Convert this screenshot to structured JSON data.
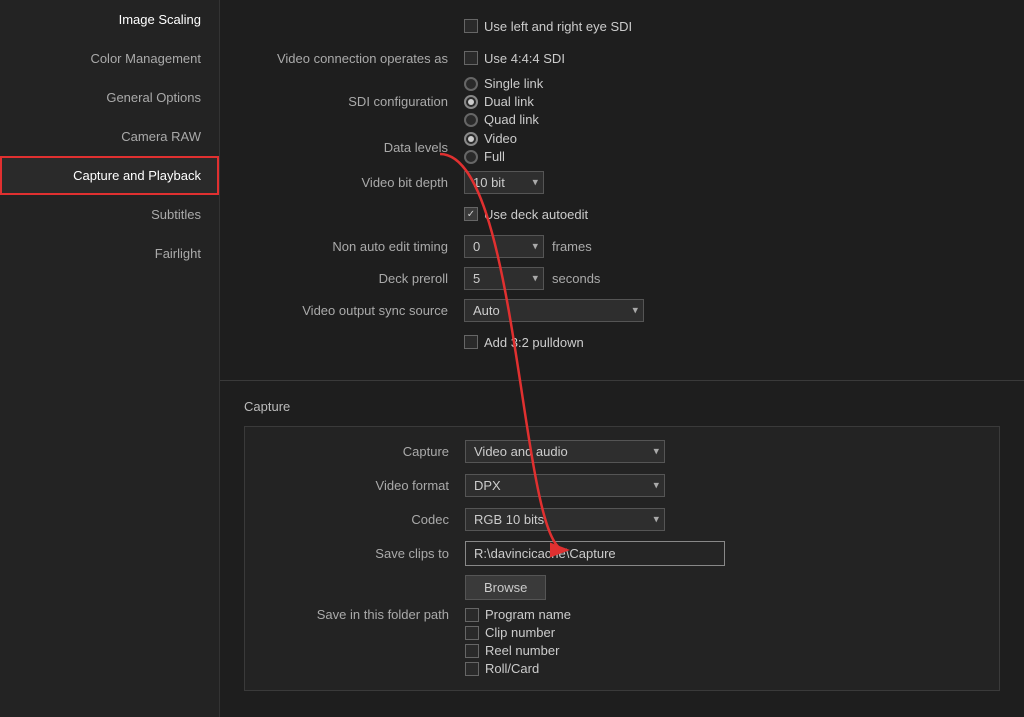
{
  "sidebar": {
    "items": [
      {
        "id": "image-scaling",
        "label": "Image Scaling",
        "active": false
      },
      {
        "id": "color-management",
        "label": "Color Management",
        "active": false
      },
      {
        "id": "general-options",
        "label": "General Options",
        "active": false
      },
      {
        "id": "camera-raw",
        "label": "Camera RAW",
        "active": false
      },
      {
        "id": "capture-and-playback",
        "label": "Capture and Playback",
        "active": true
      },
      {
        "id": "subtitles",
        "label": "Subtitles",
        "active": false
      },
      {
        "id": "fairlight",
        "label": "Fairlight",
        "active": false
      }
    ]
  },
  "settings": {
    "left_right_sdi": {
      "label": "",
      "checkbox_label": "Use left and right eye SDI",
      "checked": false
    },
    "video_connection": {
      "label": "Video connection operates as",
      "checkbox_label": "Use 4:4:4 SDI",
      "checked": false
    },
    "sdi_configuration": {
      "label": "SDI configuration",
      "options": [
        "Single link",
        "Dual link",
        "Quad link"
      ],
      "selected": "Dual link"
    },
    "data_levels": {
      "label": "Data levels",
      "options": [
        "Video",
        "Full"
      ],
      "selected": "Video"
    },
    "video_bit_depth": {
      "label": "Video bit depth",
      "value": "10 bit"
    },
    "use_deck_autoedit": {
      "label": "",
      "checkbox_label": "Use deck autoedit",
      "checked": true
    },
    "non_auto_edit_timing": {
      "label": "Non auto edit timing",
      "value": "0",
      "units": "frames"
    },
    "deck_preroll": {
      "label": "Deck preroll",
      "value": "5",
      "units": "seconds"
    },
    "video_output_sync_source": {
      "label": "Video output sync source",
      "value": "Auto"
    },
    "add_pulldown": {
      "label": "",
      "checkbox_label": "Add 3:2 pulldown",
      "checked": false
    }
  },
  "capture_section": {
    "header": "Capture",
    "capture_dropdown": {
      "label": "Capture",
      "value": "Video and audio"
    },
    "video_format_dropdown": {
      "label": "Video format",
      "value": "DPX"
    },
    "codec_dropdown": {
      "label": "Codec",
      "value": "RGB 10 bits"
    },
    "save_clips_to": {
      "label": "Save clips to",
      "value": "R:\\davincicache\\Capture"
    },
    "browse_button": "Browse",
    "save_in_folder_path": {
      "label": "Save in this folder path",
      "options": [
        {
          "label": "Program name",
          "checked": false
        },
        {
          "label": "Clip number",
          "checked": false
        },
        {
          "label": "Reel number",
          "checked": false
        },
        {
          "label": "Roll/Card",
          "checked": false
        }
      ]
    }
  }
}
